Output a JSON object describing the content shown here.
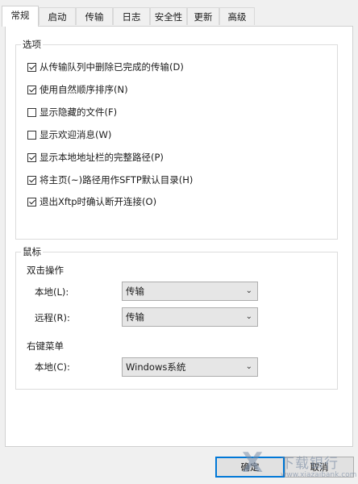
{
  "tabs": [
    "常规",
    "启动",
    "传输",
    "日志",
    "安全性",
    "更新",
    "高级"
  ],
  "options_group": {
    "title": "选项",
    "items": [
      {
        "label": "从传输队列中删除已完成的传输(D)",
        "checked": true
      },
      {
        "label": "使用自然顺序排序(N)",
        "checked": true
      },
      {
        "label": "显示隐藏的文件(F)",
        "checked": false
      },
      {
        "label": "显示欢迎消息(W)",
        "checked": false
      },
      {
        "label": "显示本地地址栏的完整路径(P)",
        "checked": true
      },
      {
        "label": "将主页(~)路径用作SFTP默认目录(H)",
        "checked": true
      },
      {
        "label": "退出Xftp时确认断开连接(O)",
        "checked": true
      }
    ]
  },
  "mouse_group": {
    "title": "鼠标",
    "double_click": {
      "heading": "双击操作",
      "local_label": "本地(L):",
      "local_value": "传输",
      "remote_label": "远程(R):",
      "remote_value": "传输"
    },
    "right_menu": {
      "heading": "右键菜单",
      "local_label": "本地(C):",
      "local_value": "Windows系统"
    }
  },
  "buttons": {
    "ok": "确定",
    "cancel": "取消"
  },
  "watermark": {
    "logo": "X",
    "text": "下载银行",
    "url": "www.xiazaibank.com"
  }
}
